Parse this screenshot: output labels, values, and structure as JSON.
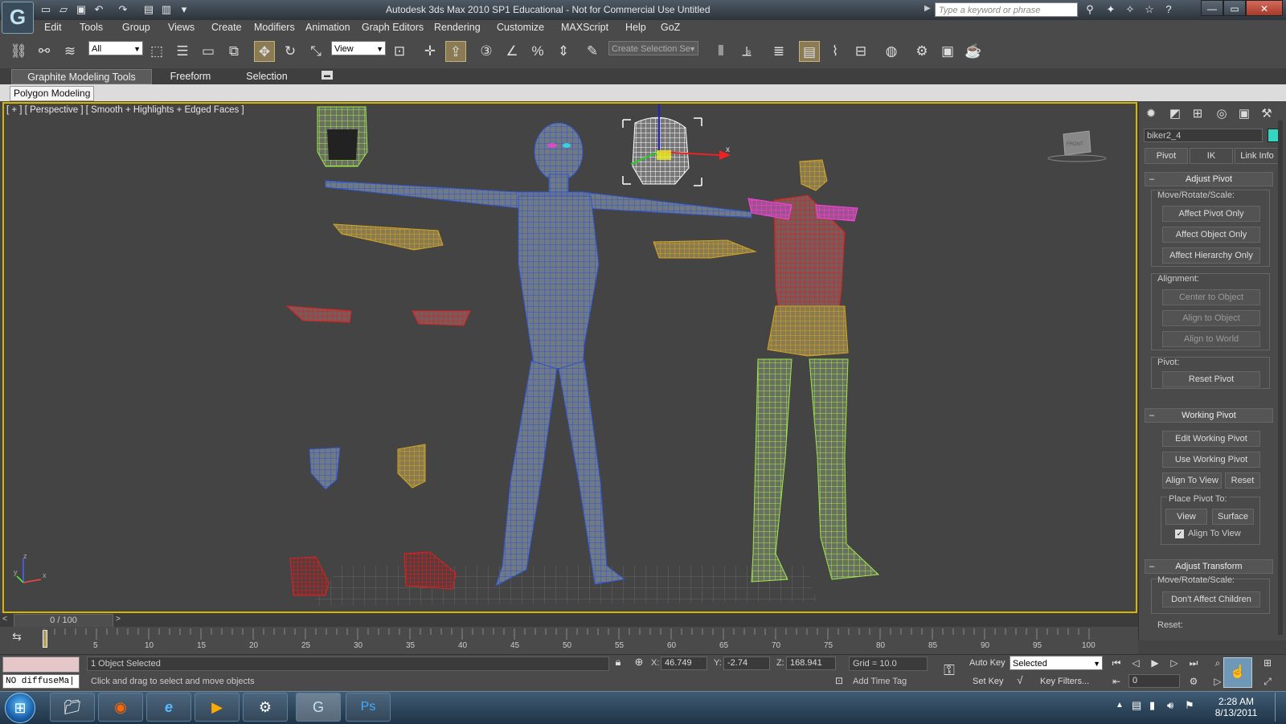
{
  "app": {
    "title": "Autodesk 3ds Max  2010 SP1    Educational - Not for Commercial Use        Untitled",
    "logo": "G",
    "search_placeholder": "Type a keyword or phrase"
  },
  "menu": [
    "Edit",
    "Tools",
    "Group",
    "Views",
    "Create",
    "Modifiers",
    "Animation",
    "Graph Editors",
    "Rendering",
    "Customize",
    "MAXScript",
    "Help",
    "GoZ"
  ],
  "toolbar": {
    "selection_filter": "All",
    "ref_coord": "View",
    "named_selection_placeholder": "Create Selection Se"
  },
  "ribbon": {
    "tabs": [
      "Graphite Modeling Tools",
      "Freeform",
      "Selection"
    ],
    "panel": "Polygon Modeling"
  },
  "viewport": {
    "label": "[ + ] [ Perspective ] [ Smooth + Highlights + Edged Faces ]",
    "gizmo_x": "x",
    "viewcube": "FRONT",
    "axis_z": "z",
    "axis_y": "y",
    "axis_x": "x"
  },
  "command_panel": {
    "object_name": "biker2_4",
    "object_color": "#33d6c0",
    "hierarchy_tabs": [
      "Pivot",
      "IK",
      "Link Info"
    ],
    "adjust_pivot": {
      "title": "Adjust Pivot",
      "move_label": "Move/Rotate/Scale:",
      "buttons": [
        "Affect Pivot Only",
        "Affect Object Only",
        "Affect Hierarchy Only"
      ],
      "alignment_label": "Alignment:",
      "align_buttons": [
        "Center to Object",
        "Align to Object",
        "Align to World"
      ],
      "pivot_label": "Pivot:",
      "reset_pivot": "Reset Pivot"
    },
    "working_pivot": {
      "title": "Working Pivot",
      "edit": "Edit Working Pivot",
      "use": "Use Working Pivot",
      "align_to_view": "Align To View",
      "reset": "Reset",
      "place_label": "Place Pivot To:",
      "view": "View",
      "surface": "Surface",
      "align_check": "Align To View"
    },
    "adjust_transform": {
      "title": "Adjust Transform",
      "move_label": "Move/Rotate/Scale:",
      "dont_affect": "Don't Affect Children",
      "reset_label": "Reset:"
    }
  },
  "timeline": {
    "counter": "0 / 100",
    "ticks": [
      "5",
      "10",
      "15",
      "20",
      "25",
      "30",
      "35",
      "40",
      "45",
      "50",
      "55",
      "60",
      "65",
      "70",
      "75",
      "80",
      "85",
      "90",
      "95",
      "100"
    ]
  },
  "status": {
    "maxscript": "NO diffuseMa|",
    "selected": "1 Object Selected",
    "prompt": "Click and drag to select and move objects",
    "x_label": "X:",
    "x": "46.749",
    "y_label": "Y:",
    "y": "-2.74",
    "z_label": "Z:",
    "z": "168.941",
    "grid": "Grid = 10.0",
    "add_time_tag": "Add Time Tag",
    "auto_key": "Auto Key",
    "set_key": "Set Key",
    "key_mode": "Selected",
    "key_filters": "Key Filters...",
    "frame": "0"
  },
  "taskbar": {
    "time": "2:28 AM",
    "date": "8/13/2011",
    "photoshop": "Ps"
  }
}
